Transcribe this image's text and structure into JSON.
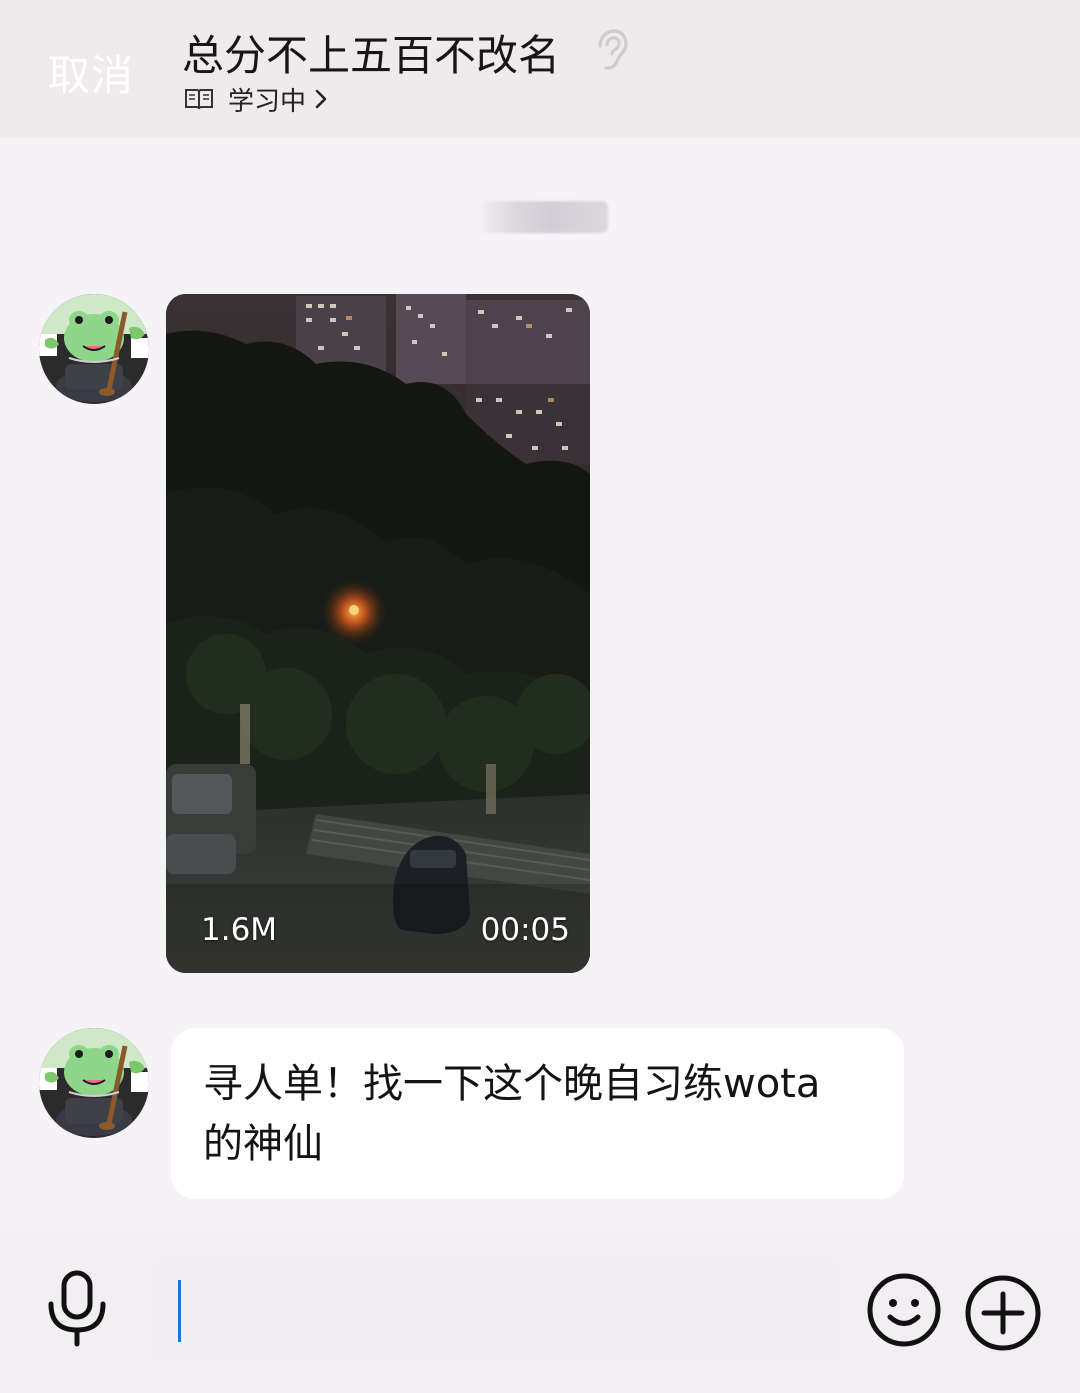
{
  "header": {
    "cancel_label": "取消",
    "title": "总分不上五百不改名",
    "status_text": "学习中",
    "icons": [
      "ear-icon",
      "book-icon",
      "chevron-right-icon"
    ]
  },
  "messages": [
    {
      "type": "video",
      "size": "1.6M",
      "duration": "00:05"
    },
    {
      "type": "text",
      "text": "寻人单！找一下这个晚自习练wota的神仙"
    }
  ],
  "input_bar": {
    "value": "",
    "icons": [
      "microphone-icon",
      "smiley-icon",
      "plus-icon"
    ]
  },
  "colors": {
    "header_bg": "#efeaec",
    "page_bg": "#f5f3f6",
    "bubble_bg": "#ffffff",
    "caret": "#1f73d9"
  }
}
